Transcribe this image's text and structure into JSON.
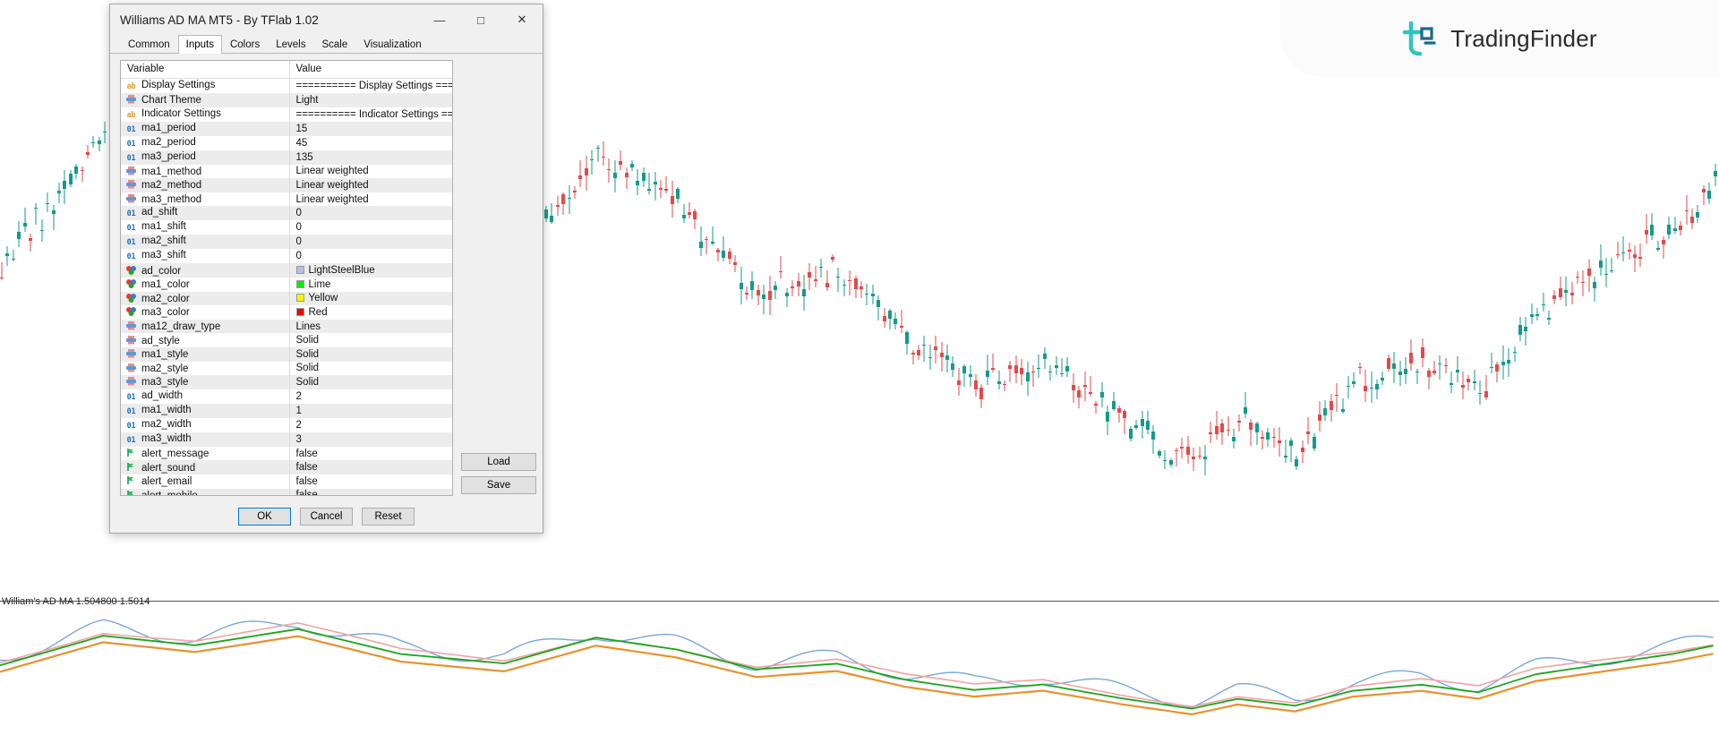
{
  "logo": {
    "text": "TradingFinder",
    "mark": "tf-logo-icon",
    "color": "#2ec4c4"
  },
  "chart": {
    "indicator_label": "William's AD MA 1.504800 1.5014",
    "theme": "Light",
    "ma_colors": {
      "ad": "#7aa7d9",
      "ma1": "#1aa51a",
      "ma2": "#f2a3a3",
      "ma3": "#e8922e"
    },
    "candle_up": "#159a8a",
    "candle_down": "#e24a4a"
  },
  "dialog": {
    "title": "Williams AD MA MT5 - By TFlab 1.02",
    "window_controls": {
      "minimize": "—",
      "maximize": "□",
      "close": "✕"
    },
    "tabs": [
      {
        "label": "Common",
        "active": false
      },
      {
        "label": "Inputs",
        "active": true
      },
      {
        "label": "Colors",
        "active": false
      },
      {
        "label": "Levels",
        "active": false
      },
      {
        "label": "Scale",
        "active": false
      },
      {
        "label": "Visualization",
        "active": false
      }
    ],
    "grid": {
      "headers": {
        "variable": "Variable",
        "value": "Value"
      },
      "rows": [
        {
          "icon": "string-param-icon",
          "type": "string",
          "name": "Display Settings",
          "value": "========== Display Settings ======...",
          "swatch": null
        },
        {
          "icon": "enum-param-icon",
          "type": "enum",
          "name": "Chart Theme",
          "value": "Light",
          "swatch": null
        },
        {
          "icon": "string-param-icon",
          "type": "string",
          "name": "Indicator Settings",
          "value": "========== Indicator Settings =====...",
          "swatch": null
        },
        {
          "icon": "int-param-icon",
          "type": "int",
          "name": "ma1_period",
          "value": "15",
          "swatch": null
        },
        {
          "icon": "int-param-icon",
          "type": "int",
          "name": "ma2_period",
          "value": "45",
          "swatch": null
        },
        {
          "icon": "int-param-icon",
          "type": "int",
          "name": "ma3_period",
          "value": "135",
          "swatch": null
        },
        {
          "icon": "enum-param-icon",
          "type": "enum",
          "name": "ma1_method",
          "value": "Linear weighted",
          "swatch": null
        },
        {
          "icon": "enum-param-icon",
          "type": "enum",
          "name": "ma2_method",
          "value": "Linear weighted",
          "swatch": null
        },
        {
          "icon": "enum-param-icon",
          "type": "enum",
          "name": "ma3_method",
          "value": "Linear weighted",
          "swatch": null
        },
        {
          "icon": "int-param-icon",
          "type": "int",
          "name": "ad_shift",
          "value": "0",
          "swatch": null
        },
        {
          "icon": "int-param-icon",
          "type": "int",
          "name": "ma1_shift",
          "value": "0",
          "swatch": null
        },
        {
          "icon": "int-param-icon",
          "type": "int",
          "name": "ma2_shift",
          "value": "0",
          "swatch": null
        },
        {
          "icon": "int-param-icon",
          "type": "int",
          "name": "ma3_shift",
          "value": "0",
          "swatch": null
        },
        {
          "icon": "color-param-icon",
          "type": "color",
          "name": "ad_color",
          "value": "LightSteelBlue",
          "swatch": "#b0c4de"
        },
        {
          "icon": "color-param-icon",
          "type": "color",
          "name": "ma1_color",
          "value": "Lime",
          "swatch": "#00ee00"
        },
        {
          "icon": "color-param-icon",
          "type": "color",
          "name": "ma2_color",
          "value": "Yellow",
          "swatch": "#f5f500"
        },
        {
          "icon": "color-param-icon",
          "type": "color",
          "name": "ma3_color",
          "value": "Red",
          "swatch": "#f50000"
        },
        {
          "icon": "enum-param-icon",
          "type": "enum",
          "name": "ma12_draw_type",
          "value": "Lines",
          "swatch": null
        },
        {
          "icon": "enum-param-icon",
          "type": "enum",
          "name": "ad_style",
          "value": "Solid",
          "swatch": null
        },
        {
          "icon": "enum-param-icon",
          "type": "enum",
          "name": "ma1_style",
          "value": "Solid",
          "swatch": null
        },
        {
          "icon": "enum-param-icon",
          "type": "enum",
          "name": "ma2_style",
          "value": "Solid",
          "swatch": null
        },
        {
          "icon": "enum-param-icon",
          "type": "enum",
          "name": "ma3_style",
          "value": "Solid",
          "swatch": null
        },
        {
          "icon": "int-param-icon",
          "type": "int",
          "name": "ad_width",
          "value": "2",
          "swatch": null
        },
        {
          "icon": "int-param-icon",
          "type": "int",
          "name": "ma1_width",
          "value": "1",
          "swatch": null
        },
        {
          "icon": "int-param-icon",
          "type": "int",
          "name": "ma2_width",
          "value": "2",
          "swatch": null
        },
        {
          "icon": "int-param-icon",
          "type": "int",
          "name": "ma3_width",
          "value": "3",
          "swatch": null
        },
        {
          "icon": "bool-param-icon",
          "type": "bool",
          "name": "alert_message",
          "value": "false",
          "swatch": null
        },
        {
          "icon": "bool-param-icon",
          "type": "bool",
          "name": "alert_sound",
          "value": "false",
          "swatch": null
        },
        {
          "icon": "bool-param-icon",
          "type": "bool",
          "name": "alert_email",
          "value": "false",
          "swatch": null
        },
        {
          "icon": "bool-param-icon",
          "type": "bool",
          "name": "alert_mobile",
          "value": "false",
          "swatch": null
        }
      ]
    },
    "side_buttons": [
      {
        "label": "Load",
        "name": "load-button"
      },
      {
        "label": "Save",
        "name": "save-button"
      }
    ],
    "bottom_buttons": [
      {
        "label": "OK",
        "name": "ok-button",
        "default": true
      },
      {
        "label": "Cancel",
        "name": "cancel-button",
        "default": false
      },
      {
        "label": "Reset",
        "name": "reset-button",
        "default": false
      }
    ]
  }
}
